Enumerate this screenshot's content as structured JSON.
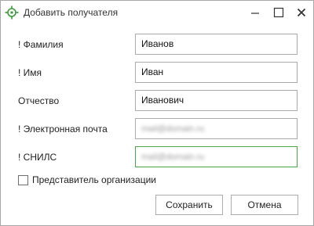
{
  "window": {
    "title": "Добавить получателя",
    "controls": [
      "minimize-icon",
      "maximize-icon",
      "close-icon"
    ]
  },
  "form": {
    "fields": [
      {
        "label": "! Фамилия",
        "value": "Иванов"
      },
      {
        "label": "! Имя",
        "value": "Иван"
      },
      {
        "label": "Отчество",
        "value": "Иванович"
      },
      {
        "label": "! Электронная почта",
        "value": "mail@domain.ru",
        "obscured": true
      },
      {
        "label": "! СНИЛС",
        "value": "mail@domain.ru",
        "obscured": true
      }
    ],
    "checkbox": {
      "label": "Представитель организации",
      "checked": false
    }
  },
  "buttons": {
    "save": "Сохранить",
    "cancel": "Отмена"
  },
  "colors": {
    "icon_green": "#3a9a3a",
    "active_field_border": "#47a447",
    "border": "#ababab"
  }
}
